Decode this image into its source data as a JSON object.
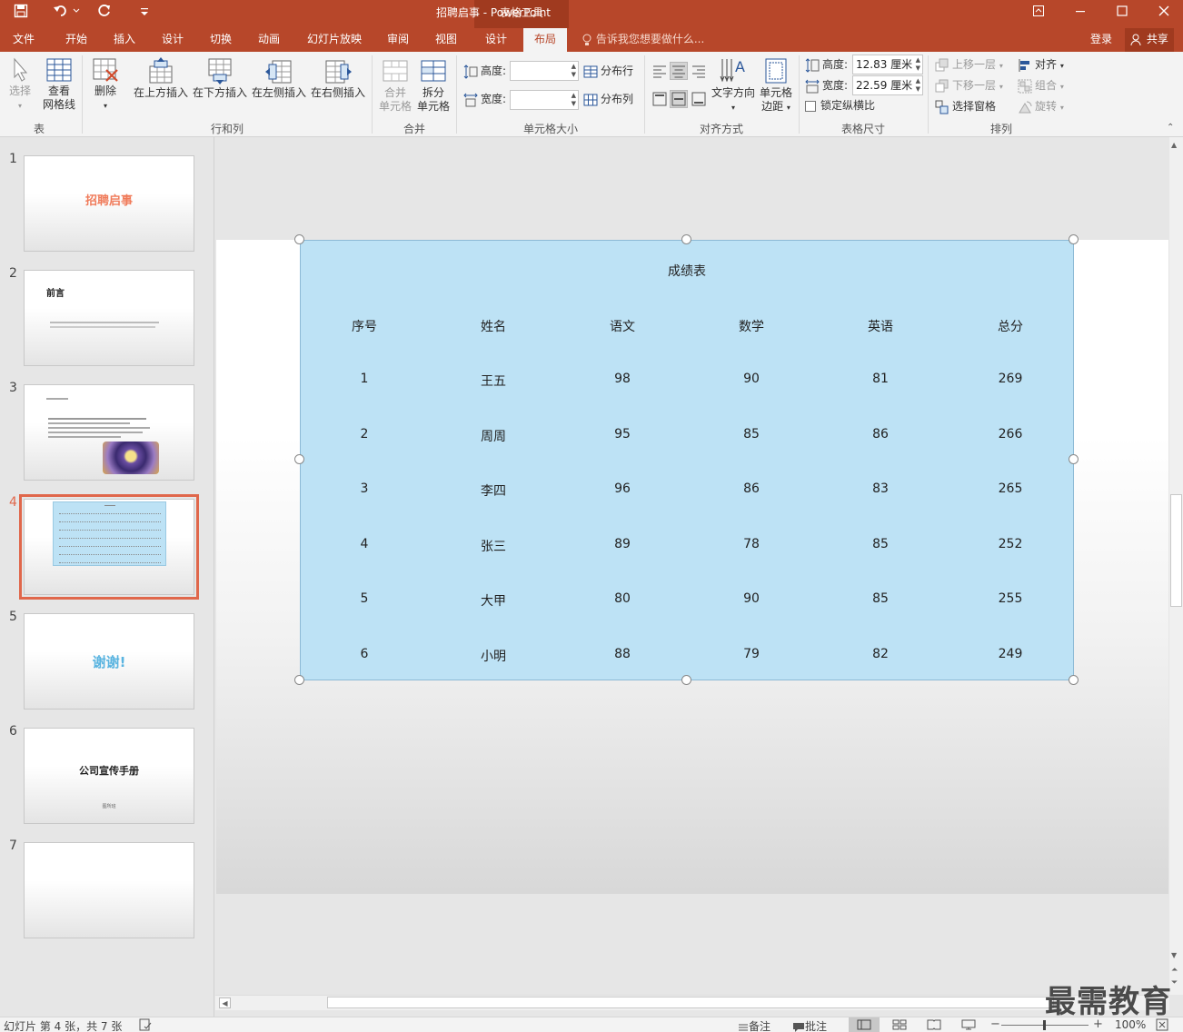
{
  "titlebar": {
    "title": "招聘启事 - PowerPoint",
    "context_tab": "表格工具"
  },
  "tabs": [
    {
      "label": "文件"
    },
    {
      "label": "开始"
    },
    {
      "label": "插入"
    },
    {
      "label": "设计"
    },
    {
      "label": "切换"
    },
    {
      "label": "动画"
    },
    {
      "label": "幻灯片放映"
    },
    {
      "label": "审阅"
    },
    {
      "label": "视图"
    },
    {
      "label": "设计"
    },
    {
      "label": "布局"
    }
  ],
  "tell_me": "告诉我您想要做什么...",
  "login": "登录",
  "share": "共享",
  "ribbon": {
    "group_table": {
      "label": "表",
      "select": "选择",
      "gridlines_1": "查看",
      "gridlines_2": "网格线"
    },
    "group_rowcol": {
      "label": "行和列",
      "delete": "删除",
      "insert_above": "在上方插入",
      "insert_below": "在下方插入",
      "insert_left": "在左侧插入",
      "insert_right": "在右侧插入"
    },
    "group_merge": {
      "label": "合并",
      "merge_1": "合并",
      "merge_2": "单元格",
      "split_1": "拆分",
      "split_2": "单元格"
    },
    "group_cellsize": {
      "label": "单元格大小",
      "height_label": "高度:",
      "width_label": "宽度:",
      "dist_rows": "分布行",
      "dist_cols": "分布列"
    },
    "group_align": {
      "label": "对齐方式",
      "text_dir": "文字方向",
      "margins_1": "单元格",
      "margins_2": "边距"
    },
    "group_tablesize": {
      "label": "表格尺寸",
      "height_label": "高度:",
      "height_value": "12.83 厘米",
      "width_label": "宽度:",
      "width_value": "22.59 厘米",
      "lock": "锁定纵横比"
    },
    "group_arrange": {
      "label": "排列",
      "forward": "上移一层",
      "backward": "下移一层",
      "pane": "选择窗格",
      "align": "对齐",
      "group": "组合",
      "rotate": "旋转"
    }
  },
  "thumbnails": [
    {
      "num": "1",
      "title": "招聘启事"
    },
    {
      "num": "2",
      "title": "前言"
    },
    {
      "num": "3",
      "title": ""
    },
    {
      "num": "4",
      "title": ""
    },
    {
      "num": "5",
      "title": "谢谢!"
    },
    {
      "num": "6",
      "title": "公司宣传手册",
      "subtitle": "图所班"
    },
    {
      "num": "7",
      "title": ""
    }
  ],
  "table": {
    "title": "成绩表",
    "headers": [
      "序号",
      "姓名",
      "语文",
      "数学",
      "英语",
      "总分"
    ],
    "rows": [
      [
        "1",
        "王五",
        "98",
        "90",
        "81",
        "269"
      ],
      [
        "2",
        "周周",
        "95",
        "85",
        "86",
        "266"
      ],
      [
        "3",
        "李四",
        "96",
        "86",
        "83",
        "265"
      ],
      [
        "4",
        "张三",
        "89",
        "78",
        "85",
        "252"
      ],
      [
        "5",
        "大甲",
        "80",
        "90",
        "85",
        "255"
      ],
      [
        "6",
        "小明",
        "88",
        "79",
        "82",
        "249"
      ]
    ]
  },
  "status": {
    "slide_info": "幻灯片 第 4 张，共 7 张",
    "notes": "备注",
    "comments": "批注",
    "zoom": "100%"
  },
  "watermark": "最需教育",
  "colors": {
    "accent": "#b7472a",
    "table_fill": "#bde2f5",
    "thumb_select": "#e0674b"
  }
}
